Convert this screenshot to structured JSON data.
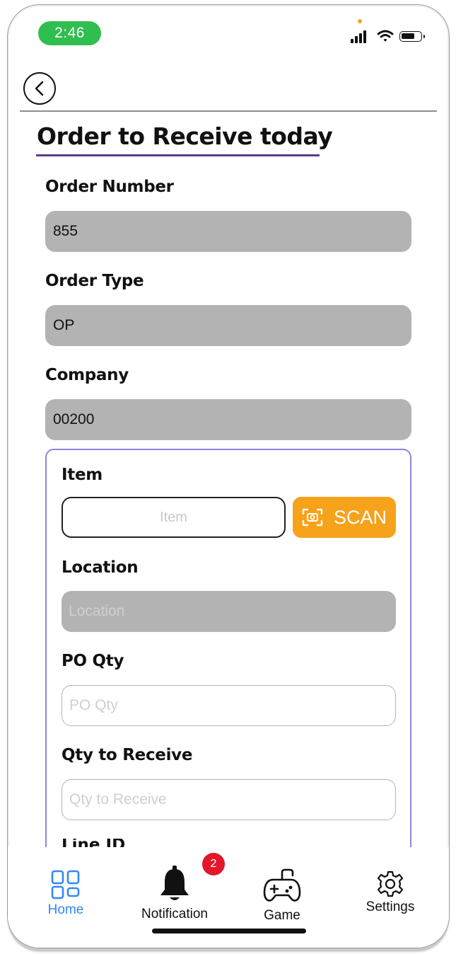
{
  "status_bar": {
    "time": "2:46"
  },
  "header": {
    "title": "Order to Receive today"
  },
  "fields": {
    "order_number": {
      "label": "Order Number",
      "value": "855"
    },
    "order_type": {
      "label": "Order Type",
      "value": "OP"
    },
    "company": {
      "label": "Company",
      "value": "00200"
    }
  },
  "line_card": {
    "item_label": "Item",
    "item_placeholder": "Item",
    "scan_label": "SCAN",
    "location_label": "Location",
    "location_placeholder": "Location",
    "po_qty_label": "PO Qty",
    "po_qty_placeholder": "PO Qty",
    "qty_receive_label": "Qty to Receive",
    "qty_receive_placeholder": "Qty to Receive",
    "line_id_label": "Line ID"
  },
  "nav": {
    "items": [
      {
        "label": "Home",
        "icon": "grid-icon",
        "active": true
      },
      {
        "label": "Notification",
        "icon": "bell-icon",
        "badge": "2"
      },
      {
        "label": "Game",
        "icon": "gamepad-icon"
      },
      {
        "label": "Settings",
        "icon": "gear-icon"
      }
    ]
  },
  "colors": {
    "accent_active": "#2f8af5",
    "scan_button": "#f7a21b",
    "title_underline": "#5a3d8c",
    "card_border": "#8f86e0",
    "time_pill": "#2fbe4f",
    "badge": "#e2182a"
  }
}
